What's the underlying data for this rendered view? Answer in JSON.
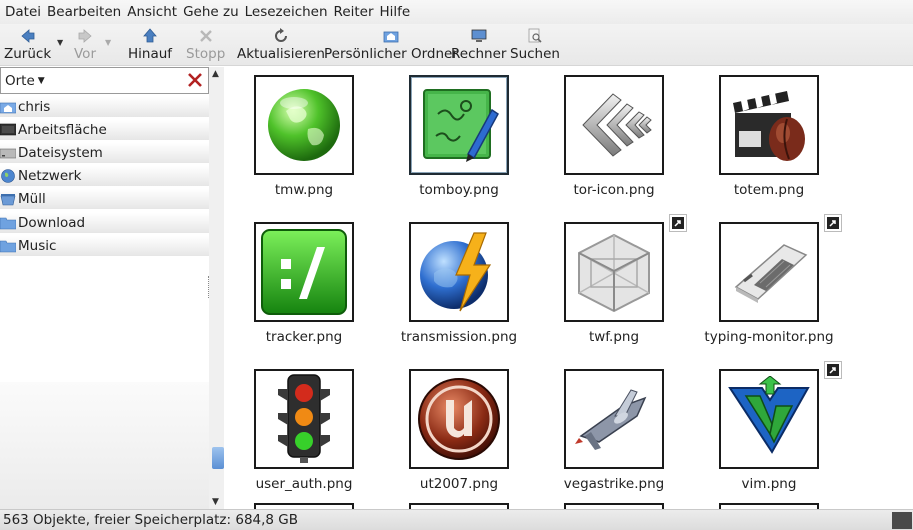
{
  "menubar": {
    "items": [
      "Datei",
      "Bearbeiten",
      "Ansicht",
      "Gehe zu",
      "Lesezeichen",
      "Reiter",
      "Hilfe"
    ]
  },
  "toolbar": {
    "back": "Zurück",
    "forward": "Vor",
    "up": "Hinauf",
    "stop": "Stopp",
    "reload": "Aktualisieren",
    "home": "Persönlicher Ordner",
    "computer": "Rechner",
    "search": "Suchen"
  },
  "sidebar": {
    "header": "Orte",
    "items": [
      "chris",
      "Arbeitsfläche",
      "Dateisystem",
      "Netzwerk",
      "Müll",
      "Download",
      "Music"
    ]
  },
  "files": [
    {
      "name": "tmw.png",
      "icon": "globe-icon"
    },
    {
      "name": "tomboy.png",
      "icon": "notepad-icon"
    },
    {
      "name": "tor-icon.png",
      "icon": "chevrons-icon"
    },
    {
      "name": "totem.png",
      "icon": "clapperboard-icon"
    },
    {
      "name": "tracker.png",
      "icon": "tracker-icon"
    },
    {
      "name": "transmission.png",
      "icon": "transmission-icon"
    },
    {
      "name": "twf.png",
      "icon": "cube-icon"
    },
    {
      "name": "typing-monitor.png",
      "icon": "keyboard-icon"
    },
    {
      "name": "user_auth.png",
      "icon": "traffic-light-icon"
    },
    {
      "name": "ut2007.png",
      "icon": "unreal-icon"
    },
    {
      "name": "vegastrike.png",
      "icon": "spaceship-icon"
    },
    {
      "name": "vim.png",
      "icon": "vim-icon"
    }
  ],
  "status": {
    "text": "563 Objekte, freier Speicherplatz: 684,8 GB"
  }
}
